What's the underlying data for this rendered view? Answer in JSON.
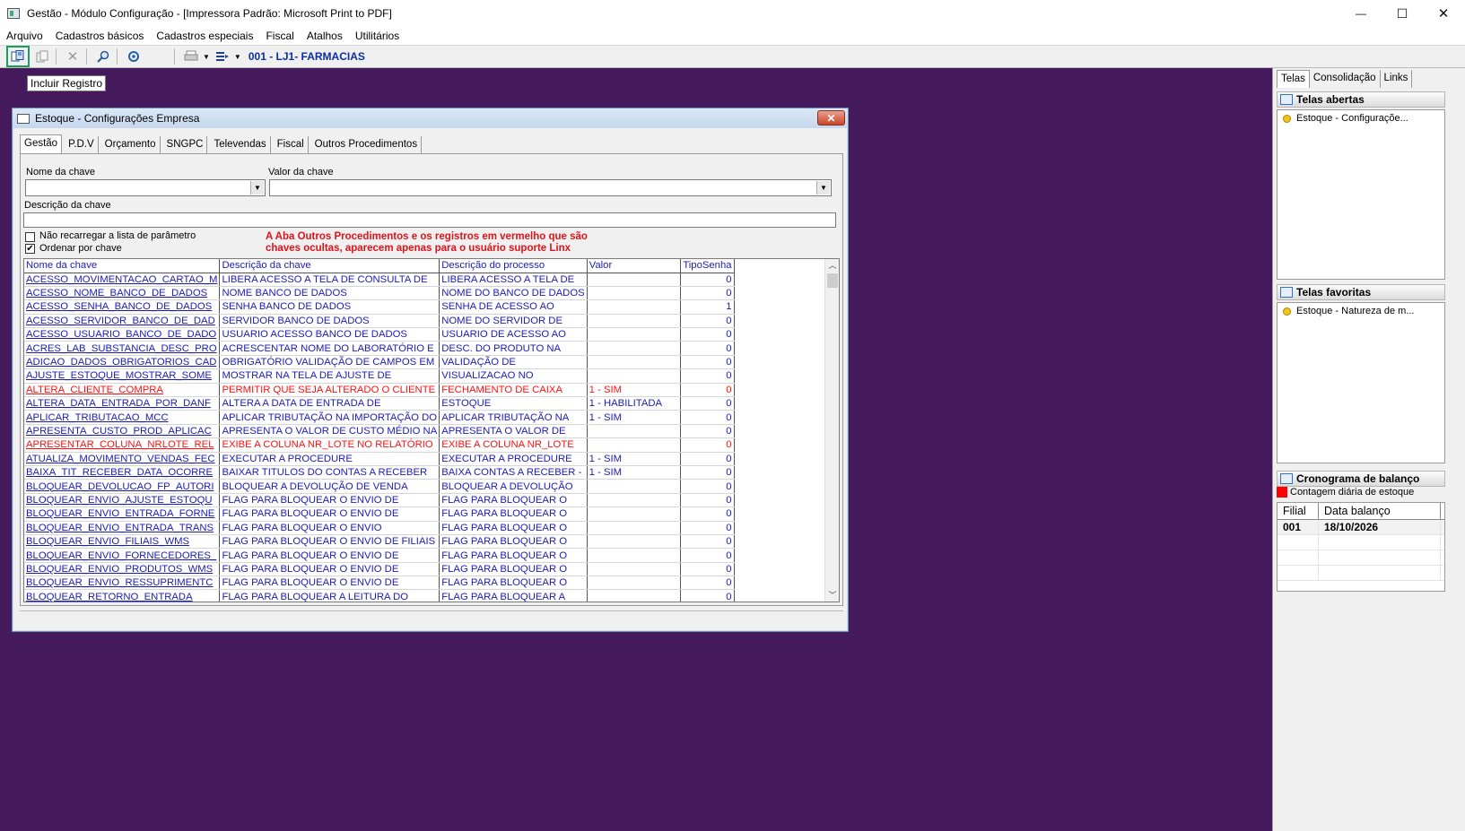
{
  "window": {
    "title": "Gestão  - Módulo Configuração - [Impressora Padrão: Microsoft Print to PDF]",
    "minimize": "—",
    "maximize": "☐",
    "close": "✕"
  },
  "menu": [
    "Arquivo",
    "Cadastros básicos",
    "Cadastros especiais",
    "Fiscal",
    "Atalhos",
    "Utilitários"
  ],
  "toolbar": {
    "store_label": "001 - LJ1- FARMACIAS",
    "tooltip": "Incluir Registro",
    "icons": [
      "include-record-icon",
      "copy-icon",
      "delete-icon",
      "search-icon",
      "settings-icon",
      "print-icon",
      "export-icon"
    ]
  },
  "dialog": {
    "title": "Estoque - Configurações Empresa",
    "tabs": [
      "Gestão",
      "P.D.V",
      "Orçamento",
      "SNGPC",
      "Televendas",
      "Fiscal",
      "Outros Procedimentos"
    ],
    "nome_chave_label": "Nome da chave",
    "valor_chave_label": "Valor da chave",
    "descricao_chave_label": "Descrição da chave",
    "nome_chave_value": "",
    "valor_chave_value": "",
    "descricao_chave_value": "",
    "nao_recarregar_label": "Não recarregar a lista de parâmetro",
    "nao_recarregar_checked": false,
    "ordenar_label": "Ordenar por chave",
    "ordenar_checked": true,
    "warning_line1": "A Aba Outros Procedimentos e os registros em vermelho que são",
    "warning_line2": "chaves ocultas, aparecem apenas para o usuário suporte Linx",
    "columns": [
      "Nome da chave",
      "Descrição  da chave",
      "Descrição do processo",
      "Valor",
      "TipoSenha"
    ],
    "rows": [
      {
        "nome": "ACESSO_MOVIMENTACAO_CARTAO_M",
        "desc": "LIBERA ACESSO A TELA DE CONSULTA DE",
        "proc": "LIBERA ACESSO A TELA DE",
        "valor": "",
        "tipo": "0",
        "hidden": false
      },
      {
        "nome": "ACESSO_NOME_BANCO_DE_DADOS",
        "desc": "NOME BANCO DE DADOS",
        "proc": "NOME DO BANCO DE DADOS",
        "valor": "",
        "tipo": "0",
        "hidden": false
      },
      {
        "nome": "ACESSO_SENHA_BANCO_DE_DADOS",
        "desc": "SENHA BANCO DE DADOS",
        "proc": "SENHA DE ACESSO AO",
        "valor": "",
        "tipo": "1",
        "hidden": false
      },
      {
        "nome": "ACESSO_SERVIDOR_BANCO_DE_DAD",
        "desc": "SERVIDOR BANCO DE DADOS",
        "proc": "NOME DO SERVIDOR DE",
        "valor": "",
        "tipo": "0",
        "hidden": false
      },
      {
        "nome": "ACESSO_USUARIO_BANCO_DE_DADO",
        "desc": "USUARIO ACESSO BANCO DE DADOS",
        "proc": "USUARIO DE ACESSO AO",
        "valor": "",
        "tipo": "0",
        "hidden": false
      },
      {
        "nome": "ACRES_LAB_SUBSTANCIA_DESC_PRO",
        "desc": "ACRESCENTAR NOME DO LABORATÓRIO E",
        "proc": "DESC. DO PRODUTO NA",
        "valor": "",
        "tipo": "0",
        "hidden": false
      },
      {
        "nome": "ADICAO_DADOS_OBRIGATORIOS_CAD",
        "desc": "OBRIGATÓRIO VALIDAÇÃO DE CAMPOS EM",
        "proc": " VALIDAÇÃO DE",
        "valor": "",
        "tipo": "0",
        "hidden": false
      },
      {
        "nome": "AJUSTE_ESTOQUE_MOSTRAR_SOME",
        "desc": "MOSTRAR NA TELA DE AJUSTE DE",
        "proc": "VISUALIZACAO NO",
        "valor": "",
        "tipo": "0",
        "hidden": false
      },
      {
        "nome": "ALTERA_CLIENTE_COMPRA",
        "desc": "PERMITIR QUE SEJA ALTERADO O CLIENTE",
        "proc": "FECHAMENTO DE CAIXA",
        "valor": "1 - SIM",
        "tipo": "0",
        "hidden": true
      },
      {
        "nome": "ALTERA_DATA_ENTRADA_POR_DANF",
        "desc": "ALTERA A DATA DE ENTRADA DE",
        "proc": "ESTOQUE",
        "valor": "1 - HABILITADA",
        "tipo": "0",
        "hidden": false
      },
      {
        "nome": "APLICAR_TRIBUTACAO_MCC",
        "desc": "APLICAR TRIBUTAÇÃO NA IMPORTAÇÃO DO",
        "proc": "APLICAR TRIBUTAÇÃO NA",
        "valor": "1 - SIM",
        "tipo": "0",
        "hidden": false
      },
      {
        "nome": "APRESENTA_CUSTO_PROD_APLICAC",
        "desc": "APRESENTA O VALOR DE CUSTO MÉDIO NA",
        "proc": "APRESENTA O VALOR DE",
        "valor": "",
        "tipo": "0",
        "hidden": false
      },
      {
        "nome": "APRESENTAR_COLUNA_NRLOTE_REL",
        "desc": "EXIBE A COLUNA NR_LOTE NO RELATÓRIO",
        "proc": "EXIBE A COLUNA NR_LOTE",
        "valor": "",
        "tipo": "0",
        "hidden": true
      },
      {
        "nome": "ATUALIZA_MOVIMENTO_VENDAS_FEC",
        "desc": "EXECUTAR A PROCEDURE",
        "proc": "EXECUTAR A PROCEDURE",
        "valor": "1 - SIM",
        "tipo": "0",
        "hidden": false
      },
      {
        "nome": "BAIXA_TIT_RECEBER_DATA_OCORRE",
        "desc": "BAIXAR TITULOS DO CONTAS A RECEBER",
        "proc": "BAIXA CONTAS A RECEBER -",
        "valor": "1 - SIM",
        "tipo": "0",
        "hidden": false
      },
      {
        "nome": "BLOQUEAR_DEVOLUCAO_FP_AUTORI",
        "desc": "BLOQUEAR A DEVOLUÇÃO DE VENDA",
        "proc": "BLOQUEAR A DEVOLUÇÃO",
        "valor": "",
        "tipo": "0",
        "hidden": false
      },
      {
        "nome": "BLOQUEAR_ENVIO_AJUSTE_ESTOQU",
        "desc": "FLAG PARA BLOQUEAR O ENVIO DE",
        "proc": "FLAG PARA BLOQUEAR O",
        "valor": "",
        "tipo": "0",
        "hidden": false
      },
      {
        "nome": "BLOQUEAR_ENVIO_ENTRADA_FORNE",
        "desc": "FLAG PARA BLOQUEAR O ENVIO DE",
        "proc": "FLAG PARA BLOQUEAR O",
        "valor": "",
        "tipo": "0",
        "hidden": false
      },
      {
        "nome": "BLOQUEAR_ENVIO_ENTRADA_TRANS",
        "desc": "FLAG PARA BLOQUEAR O ENVIO",
        "proc": "FLAG PARA BLOQUEAR O",
        "valor": "",
        "tipo": "0",
        "hidden": false
      },
      {
        "nome": "BLOQUEAR_ENVIO_FILIAIS_WMS",
        "desc": "FLAG PARA BLOQUEAR O ENVIO DE FILIAIS",
        "proc": "FLAG PARA BLOQUEAR O",
        "valor": "",
        "tipo": "0",
        "hidden": false
      },
      {
        "nome": "BLOQUEAR_ENVIO_FORNECEDORES_",
        "desc": "FLAG PARA BLOQUEAR O ENVIO DE",
        "proc": "FLAG PARA BLOQUEAR O",
        "valor": "",
        "tipo": "0",
        "hidden": false
      },
      {
        "nome": "BLOQUEAR_ENVIO_PRODUTOS_WMS",
        "desc": "FLAG PARA BLOQUEAR O ENVIO DE",
        "proc": "FLAG PARA BLOQUEAR O",
        "valor": "",
        "tipo": "0",
        "hidden": false
      },
      {
        "nome": "BLOQUEAR_ENVIO_RESSUPRIMENTC",
        "desc": "FLAG PARA BLOQUEAR O ENVIO DE",
        "proc": "FLAG PARA BLOQUEAR O",
        "valor": "",
        "tipo": "0",
        "hidden": false
      },
      {
        "nome": "BLOQUEAR_RETORNO_ENTRADA",
        "desc": "FLAG PARA BLOQUEAR A LEITURA DO",
        "proc": "FLAG PARA BLOQUEAR A",
        "valor": "",
        "tipo": "0",
        "hidden": false
      }
    ]
  },
  "right_panel": {
    "tabs": [
      "Telas",
      "Consolidação",
      "Links"
    ],
    "telas_abertas_title": "Telas abertas",
    "telas_abertas_items": [
      "Estoque - Configuraçõe..."
    ],
    "telas_favoritas_title": "Telas favoritas",
    "telas_favoritas_items": [
      "Estoque - Natureza de m..."
    ],
    "cronograma_title": "Cronograma de balanço",
    "legend_label": "Contagem diária de estoque",
    "legend_color": "#ff0000",
    "balanco_columns": [
      "Filial",
      "Data balanço"
    ],
    "balanco_rows": [
      {
        "filial": "001",
        "data": "18/10/2026"
      }
    ]
  },
  "colors": {
    "desktop": "#441a5c",
    "link_blue": "#1b1bb6",
    "hidden_red": "#ff1010",
    "store_blue": "#0a2fa8"
  }
}
